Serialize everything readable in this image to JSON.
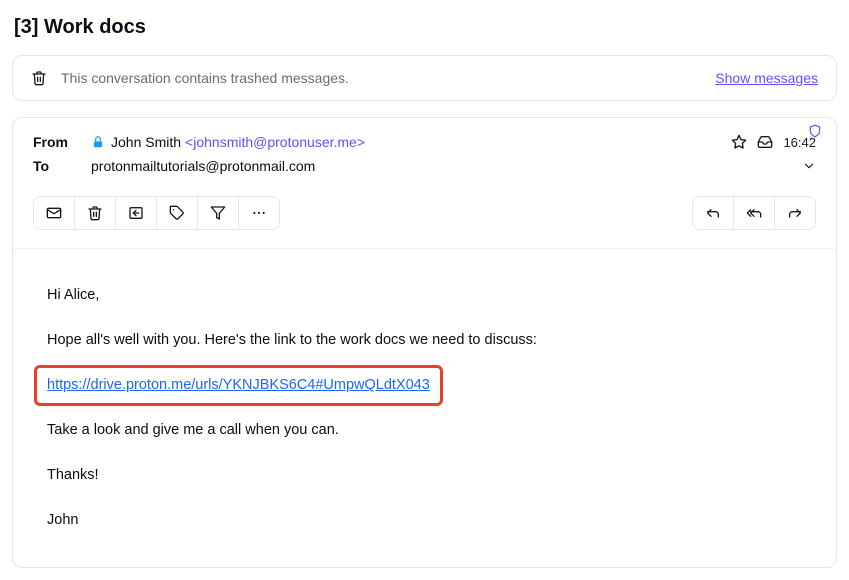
{
  "subject_prefix": "[3]",
  "subject": "Work docs",
  "banner": {
    "message": "This conversation contains trashed messages.",
    "show_link": "Show messages"
  },
  "headers": {
    "from_label": "From",
    "to_label": "To",
    "sender_name": "John Smith",
    "sender_email": "<johnsmith@protonuser.me>",
    "recipient": "protonmailtutorials@protonmail.com",
    "time": "16:42"
  },
  "body": {
    "greeting": "Hi Alice,",
    "line1": "Hope all's well with you. Here's the link to the work docs we need to discuss:",
    "link": "https://drive.proton.me/urls/YKNJBKS6C4#UmpwQLdtX043",
    "line2": "Take a look and give me a call when you can.",
    "thanks": "Thanks!",
    "signoff": "John"
  }
}
